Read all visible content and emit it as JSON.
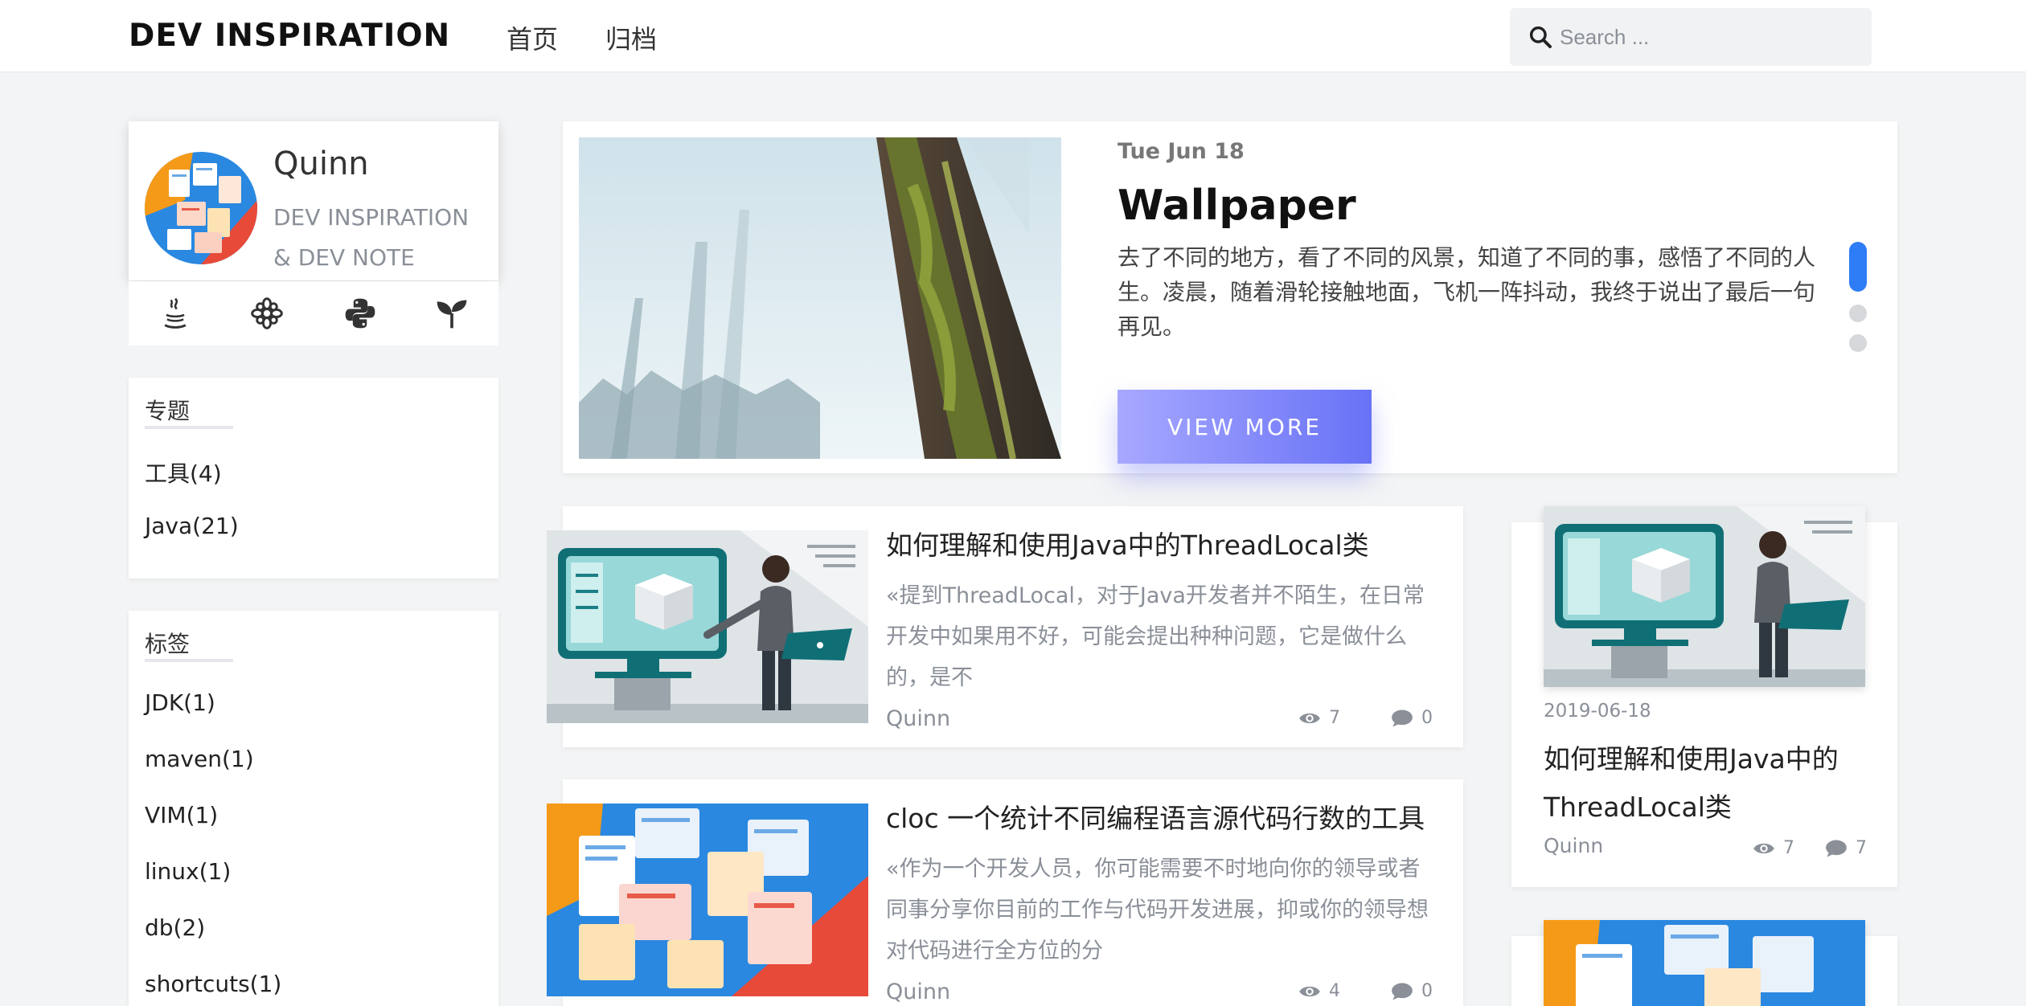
{
  "header": {
    "brand": "DEV INSPIRATION",
    "nav": [
      "首页",
      "归档"
    ],
    "search_placeholder": "Search ..."
  },
  "profile": {
    "name": "Quinn",
    "description": "DEV INSPIRATION & DEV NOTE",
    "social_icons": [
      "java-icon",
      "flower-icon",
      "python-icon",
      "sprout-icon"
    ]
  },
  "topics": {
    "title": "专题",
    "items": [
      "工具(4)",
      "Java(21)"
    ]
  },
  "tags": {
    "title": "标签",
    "items": [
      "JDK(1)",
      "maven(1)",
      "VIM(1)",
      "linux(1)",
      "db(2)",
      "shortcuts(1)"
    ]
  },
  "featured": {
    "date": "Tue Jun 18",
    "title": "Wallpaper",
    "text": "去了不同的地方，看了不同的风景，知道了不同的事，感悟了不同的人生。凌晨，随着滑轮接触地面，飞机一阵抖动，我终于说出了最后一句再见。",
    "button": "VIEW MORE",
    "carousel_active": 0
  },
  "posts": [
    {
      "title": "如何理解和使用Java中的ThreadLocal类",
      "excerpt": "«提到ThreadLocal，对于Java开发者并不陌生，在日常开发中如果用不好，可能会提出种种问题，它是做什么的，是不",
      "author": "Quinn",
      "views": "7",
      "comments": "0"
    },
    {
      "title": "cloc 一个统计不同编程语言源代码行数的工具",
      "excerpt": "«作为一个开发人员，你可能需要不时地向你的领导或者同事分享你目前的工作与代码开发进展，抑或你的领导想对代码进行全方位的分",
      "author": "Quinn",
      "views": "4",
      "comments": "0"
    }
  ],
  "side_post": {
    "date": "2019-06-18",
    "title": "如何理解和使用Java中的ThreadLocal类",
    "author": "Quinn",
    "views": "7",
    "comments": "7"
  },
  "colors": {
    "accent": "#6872f6",
    "muted": "#8a8f98",
    "background": "#f3f4f5"
  }
}
